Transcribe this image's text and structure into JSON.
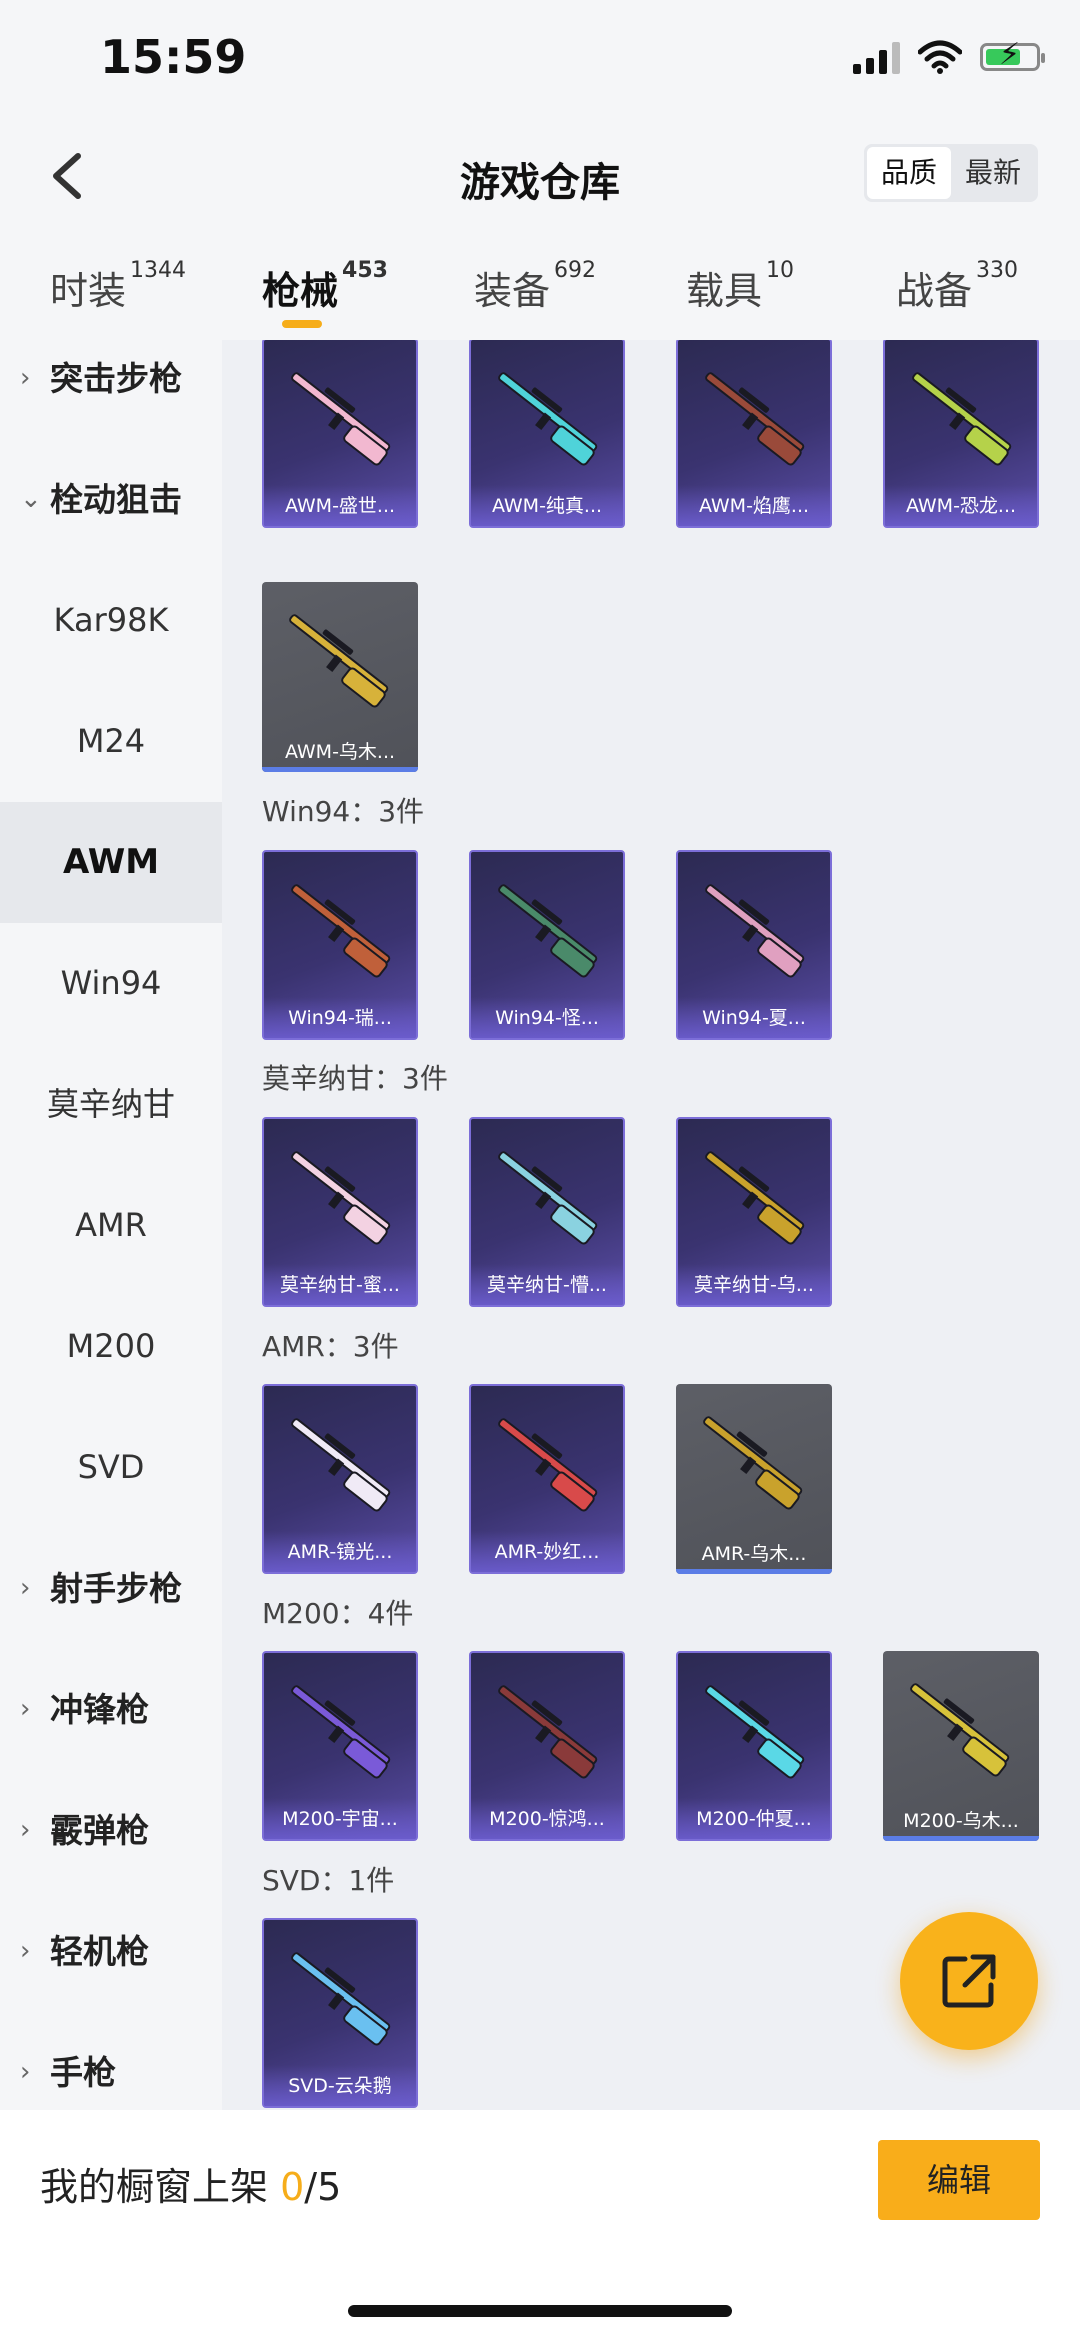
{
  "status_bar": {
    "time": "15:59"
  },
  "header": {
    "title": "游戏仓库",
    "sort_options": [
      "品质",
      "最新"
    ]
  },
  "tabs": [
    {
      "label": "时装",
      "count": "1344"
    },
    {
      "label": "枪械",
      "count": "453",
      "active": true
    },
    {
      "label": "装备",
      "count": "692"
    },
    {
      "label": "载具",
      "count": "10"
    },
    {
      "label": "战备",
      "count": "330"
    }
  ],
  "sidebar": [
    {
      "label": "突击步枪",
      "type": "category",
      "chevron": "›"
    },
    {
      "label": "栓动狙击",
      "type": "category",
      "chevron": "⌄"
    },
    {
      "label": "Kar98K"
    },
    {
      "label": "M24"
    },
    {
      "label": "AWM",
      "active": true
    },
    {
      "label": "Win94"
    },
    {
      "label": "莫辛纳甘"
    },
    {
      "label": "AMR"
    },
    {
      "label": "M200"
    },
    {
      "label": "SVD"
    },
    {
      "label": "射手步枪",
      "type": "category",
      "chevron": "›"
    },
    {
      "label": "冲锋枪",
      "type": "category",
      "chevron": "›"
    },
    {
      "label": "霰弹枪",
      "type": "category",
      "chevron": "›"
    },
    {
      "label": "轻机枪",
      "type": "category",
      "chevron": "›"
    },
    {
      "label": "手枪",
      "type": "category",
      "chevron": "›"
    }
  ],
  "sections": [
    {
      "title": "",
      "items": [
        {
          "name": "AWM-盛世...",
          "quality": "purple",
          "color": "#f2b8d0"
        },
        {
          "name": "AWM-纯真...",
          "quality": "purple",
          "color": "#4fd3d9"
        },
        {
          "name": "AWM-焰鹰...",
          "quality": "purple",
          "color": "#9a4a3a"
        },
        {
          "name": "AWM-恐龙...",
          "quality": "purple",
          "color": "#b5d24a"
        },
        {
          "name": "AWM-乌木...",
          "quality": "grey",
          "color": "#d7b23a"
        }
      ]
    },
    {
      "title": "Win94：3件",
      "items": [
        {
          "name": "Win94-瑞...",
          "quality": "purple",
          "color": "#c0603a"
        },
        {
          "name": "Win94-怪...",
          "quality": "purple",
          "color": "#4a8a6a"
        },
        {
          "name": "Win94-夏...",
          "quality": "purple",
          "color": "#e0a0c0"
        }
      ]
    },
    {
      "title": "莫辛纳甘：3件",
      "items": [
        {
          "name": "莫辛纳甘-蜜...",
          "quality": "purple",
          "color": "#f3d2e2"
        },
        {
          "name": "莫辛纳甘-懵...",
          "quality": "purple",
          "color": "#8ad2e0"
        },
        {
          "name": "莫辛纳甘-乌...",
          "quality": "purple",
          "color": "#c9a22c"
        }
      ]
    },
    {
      "title": "AMR：3件",
      "items": [
        {
          "name": "AMR-镜光...",
          "quality": "purple",
          "color": "#f0eaf6"
        },
        {
          "name": "AMR-妙红...",
          "quality": "purple",
          "color": "#d84a4a"
        },
        {
          "name": "AMR-乌木...",
          "quality": "grey",
          "color": "#c9a22c"
        }
      ]
    },
    {
      "title": "M200：4件",
      "items": [
        {
          "name": "M200-宇宙...",
          "quality": "purple",
          "color": "#7a5ad8"
        },
        {
          "name": "M200-惊鸿...",
          "quality": "purple",
          "color": "#8a3a3a"
        },
        {
          "name": "M200-仲夏...",
          "quality": "purple",
          "color": "#5ad8e6"
        },
        {
          "name": "M200-乌木...",
          "quality": "grey",
          "color": "#d7c23a"
        }
      ]
    },
    {
      "title": "SVD：1件",
      "items": [
        {
          "name": "SVD-云朵鹅",
          "quality": "purple",
          "color": "#6ac0f0"
        }
      ]
    }
  ],
  "bottom": {
    "label": "我的橱窗上架 ",
    "current": "0",
    "total": "/5",
    "edit": "编辑"
  }
}
